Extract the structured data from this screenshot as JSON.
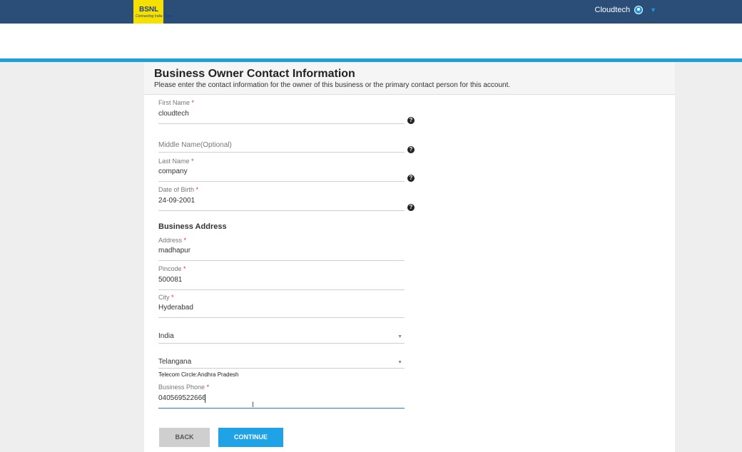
{
  "header": {
    "logo_text": "BSNL",
    "logo_tagline": "Connecting India Faster",
    "user_name": "Cloudtech"
  },
  "form": {
    "title": "Business Owner Contact Information",
    "subtitle": "Please enter the contact information for the owner of this business or the primary contact person for this account.",
    "first_name": {
      "label": "First Name",
      "value": "cloudtech"
    },
    "middle_name": {
      "placeholder": "Middle Name(Optional)"
    },
    "last_name": {
      "label": "Last Name",
      "value": "company"
    },
    "dob": {
      "label": "Date of Birth",
      "value": "24-09-2001"
    },
    "address_section": "Business Address",
    "address": {
      "label": "Address",
      "value": "madhapur"
    },
    "pincode": {
      "label": "Pincode",
      "value": "500081"
    },
    "city": {
      "label": "City",
      "value": "Hyderabad"
    },
    "country": {
      "value": "India"
    },
    "state": {
      "value": "Telangana"
    },
    "telecom_circle": "Telecom Circle:Andhra Pradesh",
    "phone": {
      "label": "Business Phone",
      "value": "040569522666"
    },
    "required_mark": "*",
    "help_glyph": "?",
    "back_label": "BACK",
    "continue_label": "CONTINUE"
  },
  "colors": {
    "topbar": "#2b4e79",
    "accent": "#1ea0dc",
    "logo_bg": "#f5e000",
    "required": "#d9362c"
  }
}
